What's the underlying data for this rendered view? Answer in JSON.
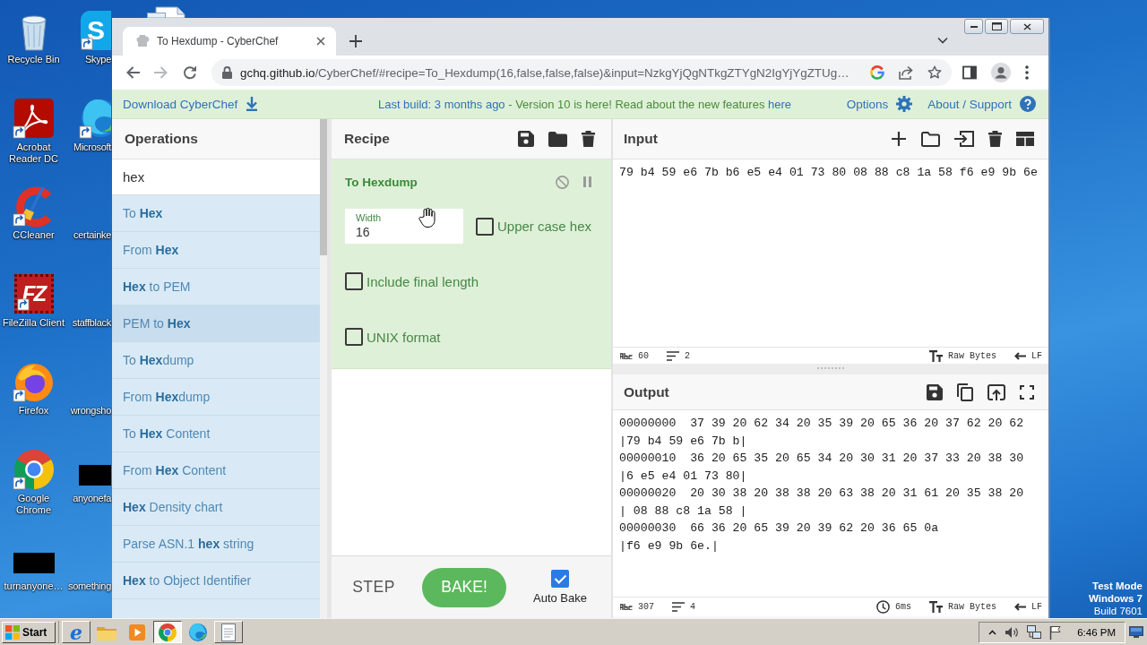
{
  "desktop": {
    "icons": [
      {
        "label": "Recycle Bin",
        "kind": "recycle-bin"
      },
      {
        "label": "Acrobat Reader DC",
        "kind": "acrobat"
      },
      {
        "label": "CCleaner",
        "kind": "ccleaner"
      },
      {
        "label": "FileZilla Client",
        "kind": "filezilla",
        "logo": "FZ"
      },
      {
        "label": "Firefox",
        "kind": "firefox"
      },
      {
        "label": "Google Chrome",
        "kind": "chrome"
      },
      {
        "label": "turnanyone…",
        "kind": "thumbnail"
      },
      {
        "label": "Skype",
        "kind": "skype",
        "logo": "S"
      },
      {
        "label": "Microsoft",
        "kind": "edge"
      },
      {
        "label": "certainke",
        "kind": "blank"
      },
      {
        "label": "staffblack",
        "kind": "blank"
      },
      {
        "label": "wrongsho",
        "kind": "blank"
      },
      {
        "label": "anyonefa",
        "kind": "thumbnail"
      },
      {
        "label": "something",
        "kind": "blank"
      }
    ],
    "system_notice": [
      "Test Mode",
      "Windows 7",
      "Build 7601"
    ]
  },
  "browser": {
    "tabs": [
      {
        "title": "To Hexdump - CyberChef",
        "selected": true
      }
    ],
    "address": {
      "host": "gchq.github.io",
      "path": "/CyberChef/#recipe=To_Hexdump(16,false,false,false)&input=NzkgYjQgNTkgZTYgN2IgYjYgZTUg…"
    }
  },
  "banner": {
    "download": "Download CyberChef",
    "notice": [
      {
        "text": "Last build: 3 months ago",
        "kind": "link"
      },
      {
        "text": " - Version 10 is here! Read about the new features ",
        "kind": "text"
      },
      {
        "text": "here",
        "kind": "link"
      }
    ],
    "options": "Options",
    "support": "About / Support"
  },
  "operations": {
    "title": "Operations",
    "search": "hex",
    "items": [
      {
        "label": "To **Hex**",
        "selected": false
      },
      {
        "label": "From **Hex**",
        "selected": false
      },
      {
        "label": "**Hex** to PEM",
        "selected": false
      },
      {
        "label": "PEM to **Hex**",
        "selected": true
      },
      {
        "label": "To **Hex**dump",
        "selected": false
      },
      {
        "label": "From **Hex**dump",
        "selected": false
      },
      {
        "label": "To **Hex** Content",
        "selected": false
      },
      {
        "label": "From **Hex** Content",
        "selected": false
      },
      {
        "label": "**Hex** Density chart",
        "selected": false
      },
      {
        "label": "Parse ASN.1 **hex** string",
        "selected": false
      },
      {
        "label": "**Hex** to Object Identifier",
        "selected": false
      }
    ]
  },
  "recipe": {
    "title": "Recipe",
    "operation": {
      "title": "To Hexdump",
      "args": [
        {
          "kind": "number",
          "label": "Width",
          "value": "16"
        },
        {
          "kind": "checkbox",
          "label": "Upper case hex",
          "checked": false
        },
        {
          "kind": "checkbox",
          "label": "Include final length",
          "checked": false
        },
        {
          "kind": "checkbox",
          "label": "UNIX format",
          "checked": false
        }
      ]
    }
  },
  "controls": {
    "step": "STEP",
    "bake": "BAKE!",
    "auto_bake": {
      "label": "Auto Bake",
      "checked": true
    }
  },
  "input": {
    "title": "Input",
    "text": "79 b4 59 e6 7b b6 e5 e4 01 73 80 08 88 c8 1a 58 f6 e9 9b 6e",
    "status": {
      "length": "60",
      "lines": "2",
      "encoding": "Raw Bytes",
      "eol": "LF"
    }
  },
  "output": {
    "title": "Output",
    "records": [
      {
        "hex": "00000000  37 39 20 62 34 20 35 39 20 65 36 20 37 62 20 62",
        "ascii": "|79 b4 59 e6 7b b|"
      },
      {
        "hex": "00000010  36 20 65 35 20 65 34 20 30 31 20 37 33 20 38 30",
        "ascii": "|6 e5 e4 01 73 80|"
      },
      {
        "hex": "00000020  20 30 38 20 38 38 20 63 38 20 31 61 20 35 38 20",
        "ascii": "| 08 88 c8 1a 58 |"
      },
      {
        "hex": "00000030  66 36 20 65 39 20 39 62 20 36 65 0a",
        "ascii": "|f6 e9 9b 6e.|"
      }
    ],
    "status": {
      "length": "307",
      "lines": "4",
      "time": "6ms",
      "encoding": "Raw Bytes",
      "eol": "LF"
    }
  },
  "taskbar": {
    "start": "Start",
    "apps": [
      {
        "kind": "ie",
        "logo": "e",
        "open": true,
        "selected": false
      },
      {
        "kind": "explorer",
        "open": false,
        "selected": false
      },
      {
        "kind": "media",
        "open": false,
        "selected": false
      },
      {
        "kind": "chrome",
        "open": true,
        "selected": true
      },
      {
        "kind": "edge",
        "open": false,
        "selected": false
      },
      {
        "kind": "notepad",
        "open": true,
        "selected": false
      }
    ],
    "clock": "6:46 PM"
  }
}
